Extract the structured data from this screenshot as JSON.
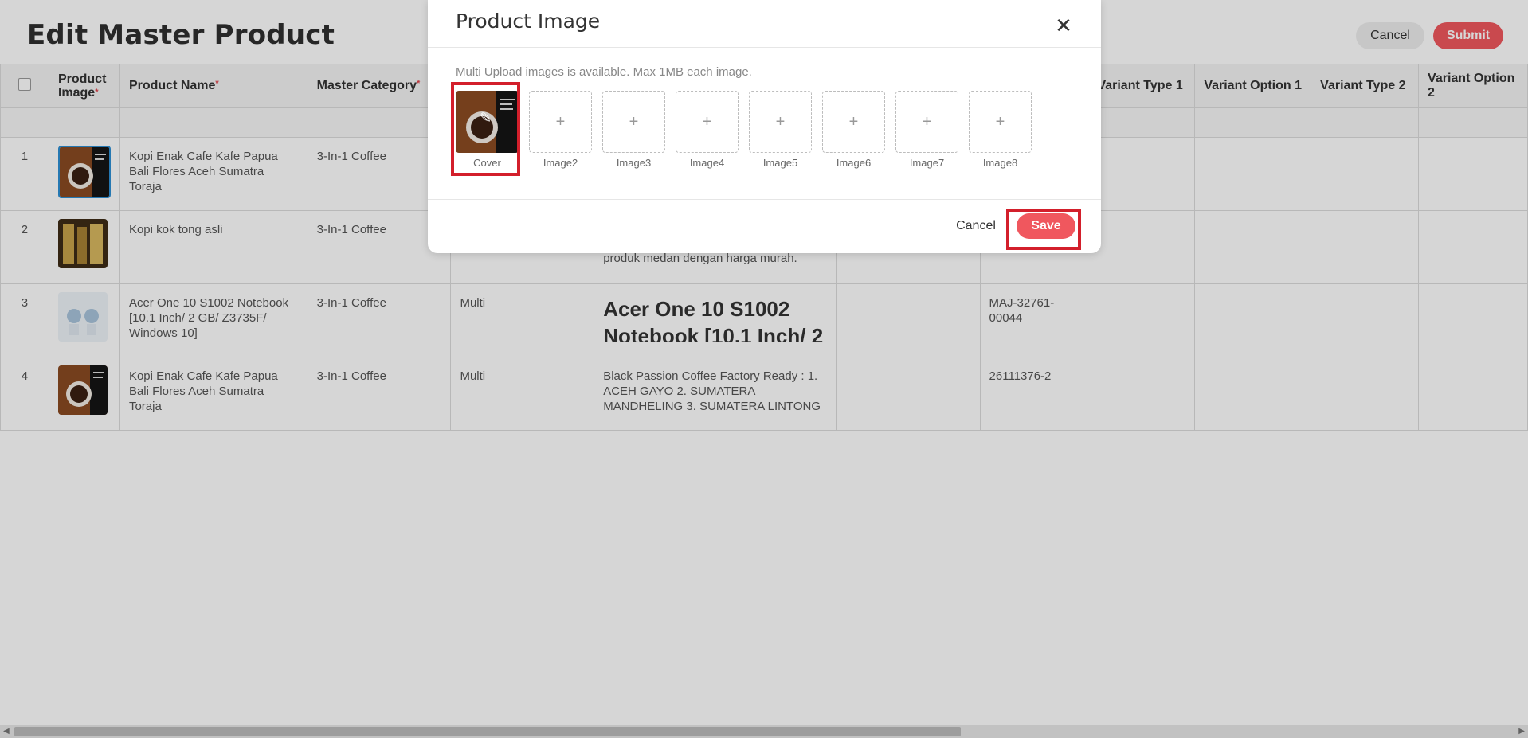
{
  "page": {
    "title": "Edit Master Product",
    "cancel_label": "Cancel",
    "submit_label": "Submit"
  },
  "table": {
    "headers": {
      "product_image": "Product Image",
      "product_name": "Product Name",
      "master_category": "Master Category",
      "variant_type_1": "Variant Type 1",
      "variant_option_1": "Variant Option 1",
      "variant_type_2": "Variant Type 2",
      "variant_option_2": "Variant Option 2"
    },
    "rows": [
      {
        "index": "1",
        "name": "Kopi Enak Cafe Kafe Papua Bali Flores Aceh Sumatra Toraja",
        "category": "3-In-1 Coffee",
        "type": "",
        "description": "",
        "sku": ""
      },
      {
        "index": "2",
        "name": "Kopi kok tong asli",
        "category": "3-In-1 Coffee",
        "type": "",
        "description": "produk medan dengan harga murah.",
        "sku": ""
      },
      {
        "index": "3",
        "name": "Acer One 10 S1002 Notebook [10.1 Inch/ 2 GB/ Z3735F/ Windows 10]",
        "category": "3-In-1 Coffee",
        "type": "Multi",
        "description": "Acer One 10 S1002 Notebook [10.1 Inch/ 2",
        "sku": "MAJ-32761-00044"
      },
      {
        "index": "4",
        "name": "Kopi Enak Cafe Kafe Papua Bali Flores Aceh Sumatra Toraja",
        "category": "3-In-1 Coffee",
        "type": "Multi",
        "description": "Black Passion Coffee Factory Ready : 1. ACEH GAYO 2. SUMATERA MANDHELING 3. SUMATERA LINTONG",
        "sku": "26111376-2"
      }
    ]
  },
  "modal": {
    "title": "Product Image",
    "hint": "Multi Upload images is available. Max 1MB each image.",
    "slots": [
      "Cover",
      "Image2",
      "Image3",
      "Image4",
      "Image5",
      "Image6",
      "Image7",
      "Image8"
    ],
    "add_glyph": "+",
    "cancel_label": "Cancel",
    "save_label": "Save"
  },
  "colors": {
    "accent": "#f0575e",
    "highlight": "#d31f2b"
  }
}
